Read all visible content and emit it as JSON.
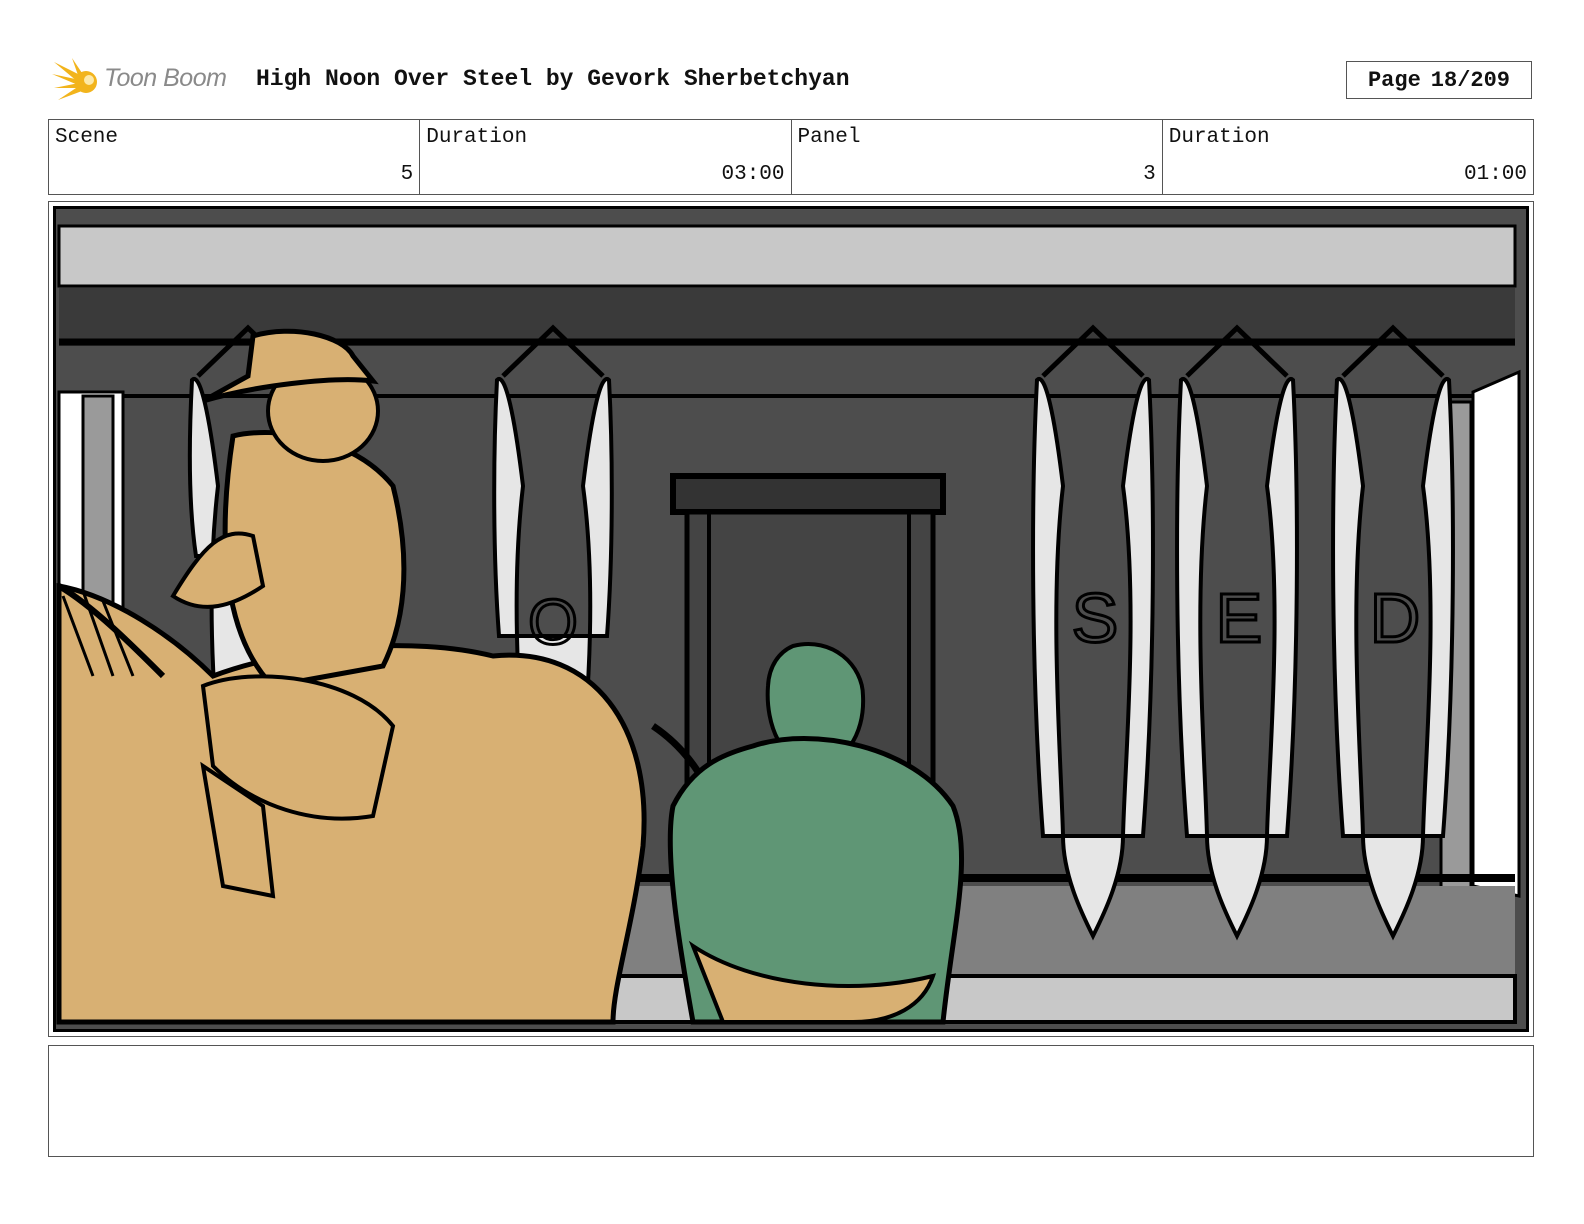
{
  "header": {
    "logo_text": "Toon Boom",
    "title": "High Noon Over Steel by Gevork Sherbetchyan",
    "page_label": "Page",
    "page_value": "18/209"
  },
  "info": {
    "scene_label": "Scene",
    "scene_value": "5",
    "scene_duration_label": "Duration",
    "scene_duration_value": "03:00",
    "panel_label": "Panel",
    "panel_value": "3",
    "panel_duration_label": "Duration",
    "panel_duration_value": "01:00"
  },
  "panel": {
    "carcass_letters": [
      "O",
      "S",
      "E",
      "D"
    ],
    "colors": {
      "rider": "#d8b073",
      "butcher": "#5f9675",
      "wall": "#4d4d4d",
      "ceiling": "#c8c8c8",
      "carcass": "#e6e6e6"
    }
  },
  "notes": {
    "text": ""
  }
}
